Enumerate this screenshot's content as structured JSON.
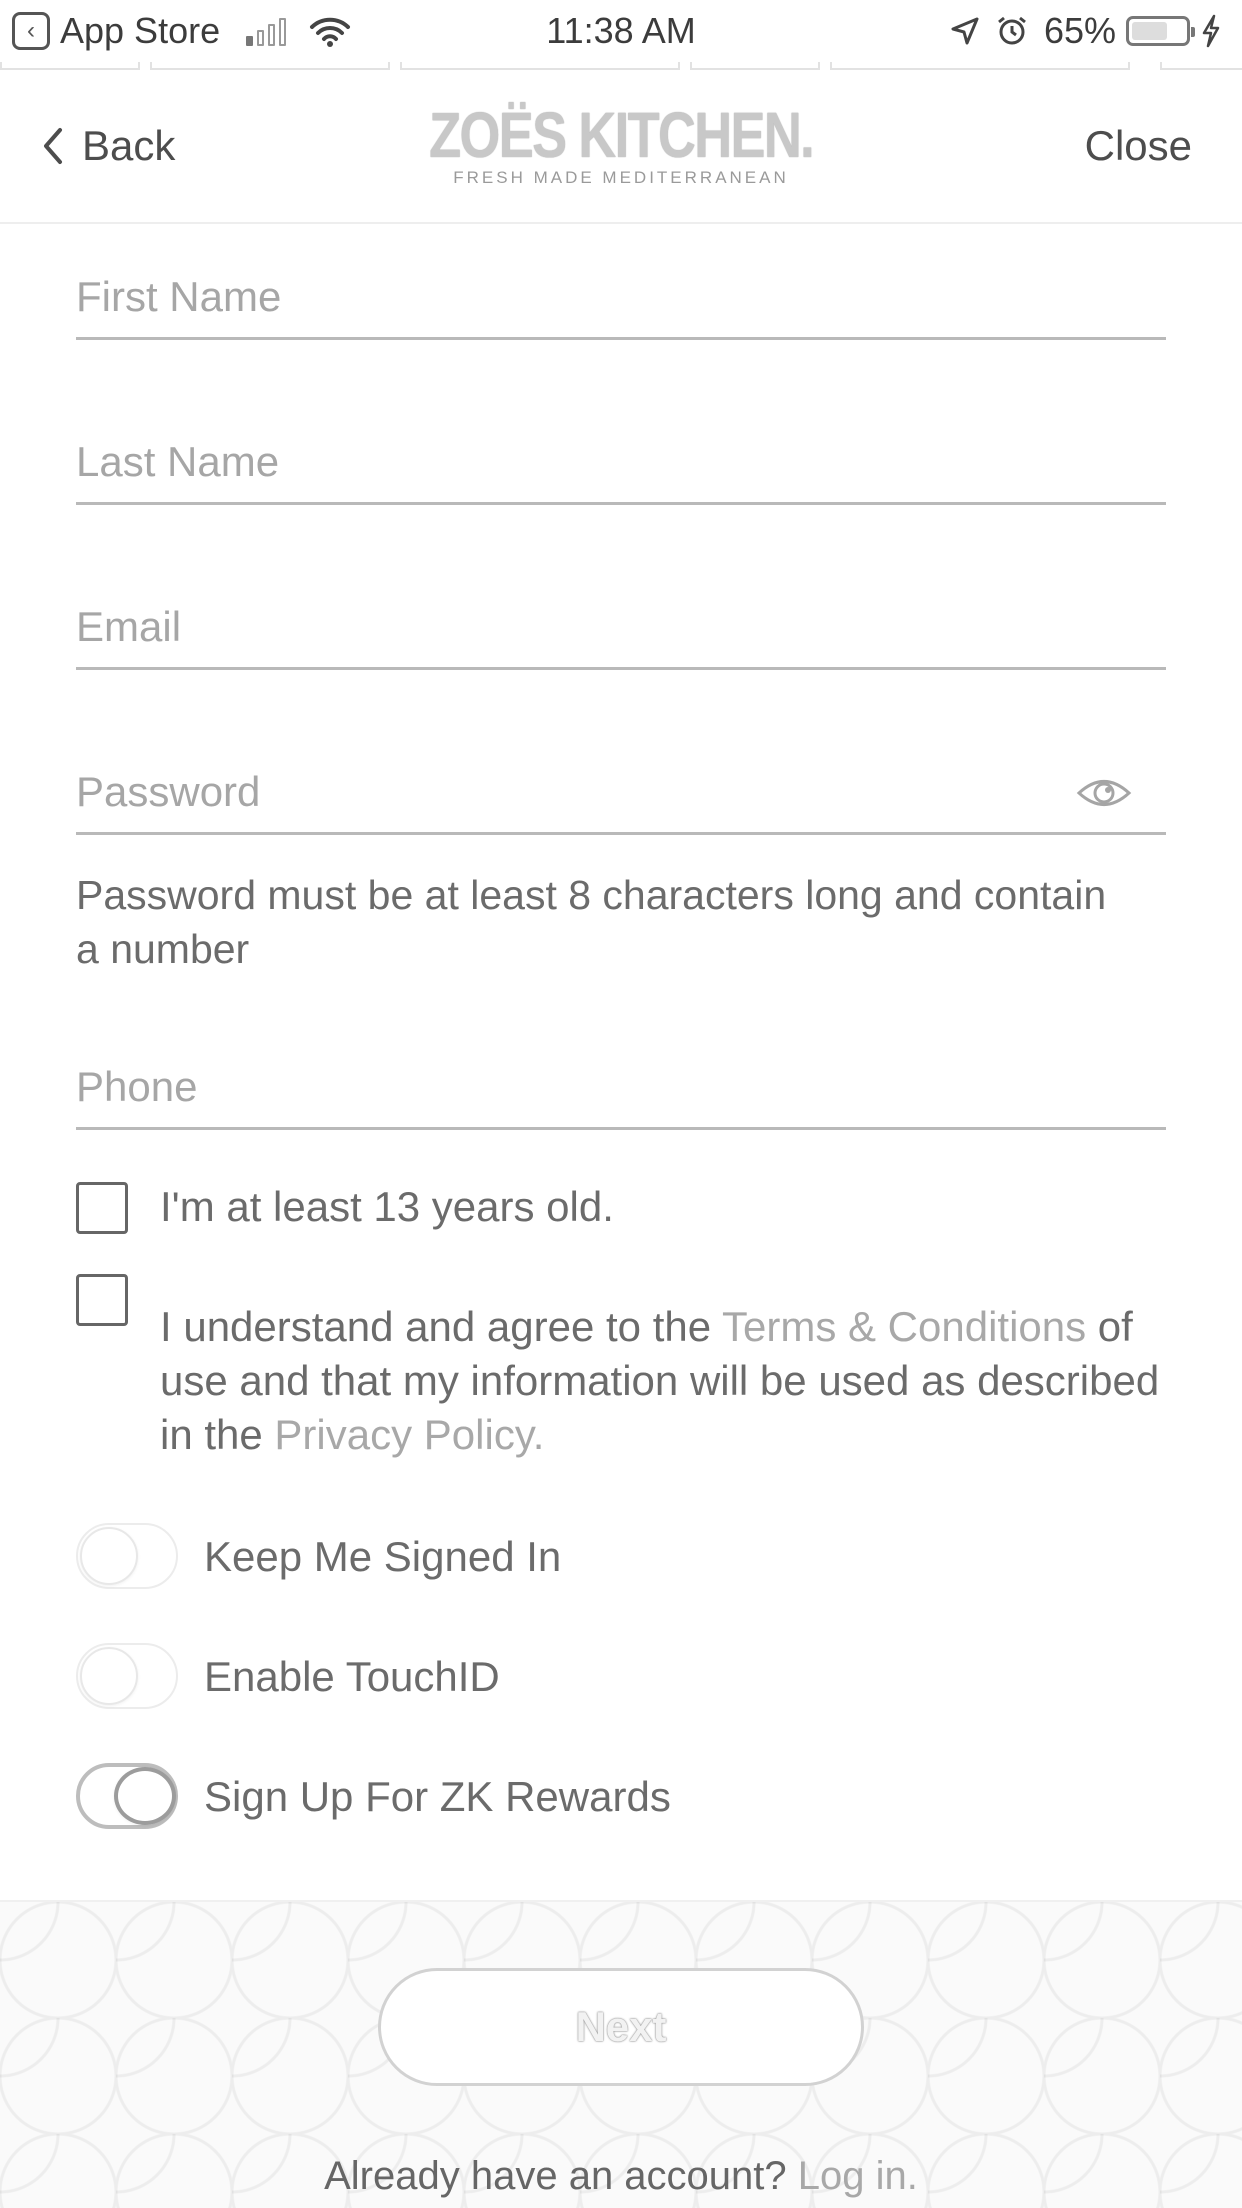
{
  "status_bar": {
    "back_app_label": "App Store",
    "time": "11:38 AM",
    "battery": "65%",
    "battery_level": 0.65
  },
  "nav": {
    "back_label": "Back",
    "close_label": "Close",
    "logo_text": "ZOËS KITCHEN.",
    "logo_tagline": "FRESH MADE MEDITERRANEAN"
  },
  "form": {
    "first_name": {
      "placeholder": "First Name",
      "value": ""
    },
    "last_name": {
      "placeholder": "Last Name",
      "value": ""
    },
    "email": {
      "placeholder": "Email",
      "value": ""
    },
    "password": {
      "placeholder": "Password",
      "value": ""
    },
    "password_hint": "Password must be at least 8 characters long and contain a number",
    "phone": {
      "placeholder": "Phone",
      "value": ""
    }
  },
  "checks": {
    "age_label": "I'm at least 13 years old.",
    "terms_prefix": "I understand and agree to the ",
    "terms_link": "Terms & Conditions",
    "terms_middle": " of use and that my information will be used as described in the ",
    "privacy_link": "Privacy Policy",
    "terms_suffix": "."
  },
  "toggles": {
    "keep_signed_in": {
      "label": "Keep Me Signed In",
      "on": false
    },
    "touch_id": {
      "label": "Enable TouchID",
      "on": false
    },
    "zk_rewards": {
      "label": "Sign Up For ZK Rewards",
      "on": true
    }
  },
  "footer": {
    "next_label": "Next",
    "login_prompt": "Already have an account? ",
    "login_link": "Log in."
  },
  "colors": {
    "text": "#6b6b6b",
    "placeholder": "#a6a6a6",
    "link": "#a8a8a8",
    "divider": "#b9b9b9"
  }
}
